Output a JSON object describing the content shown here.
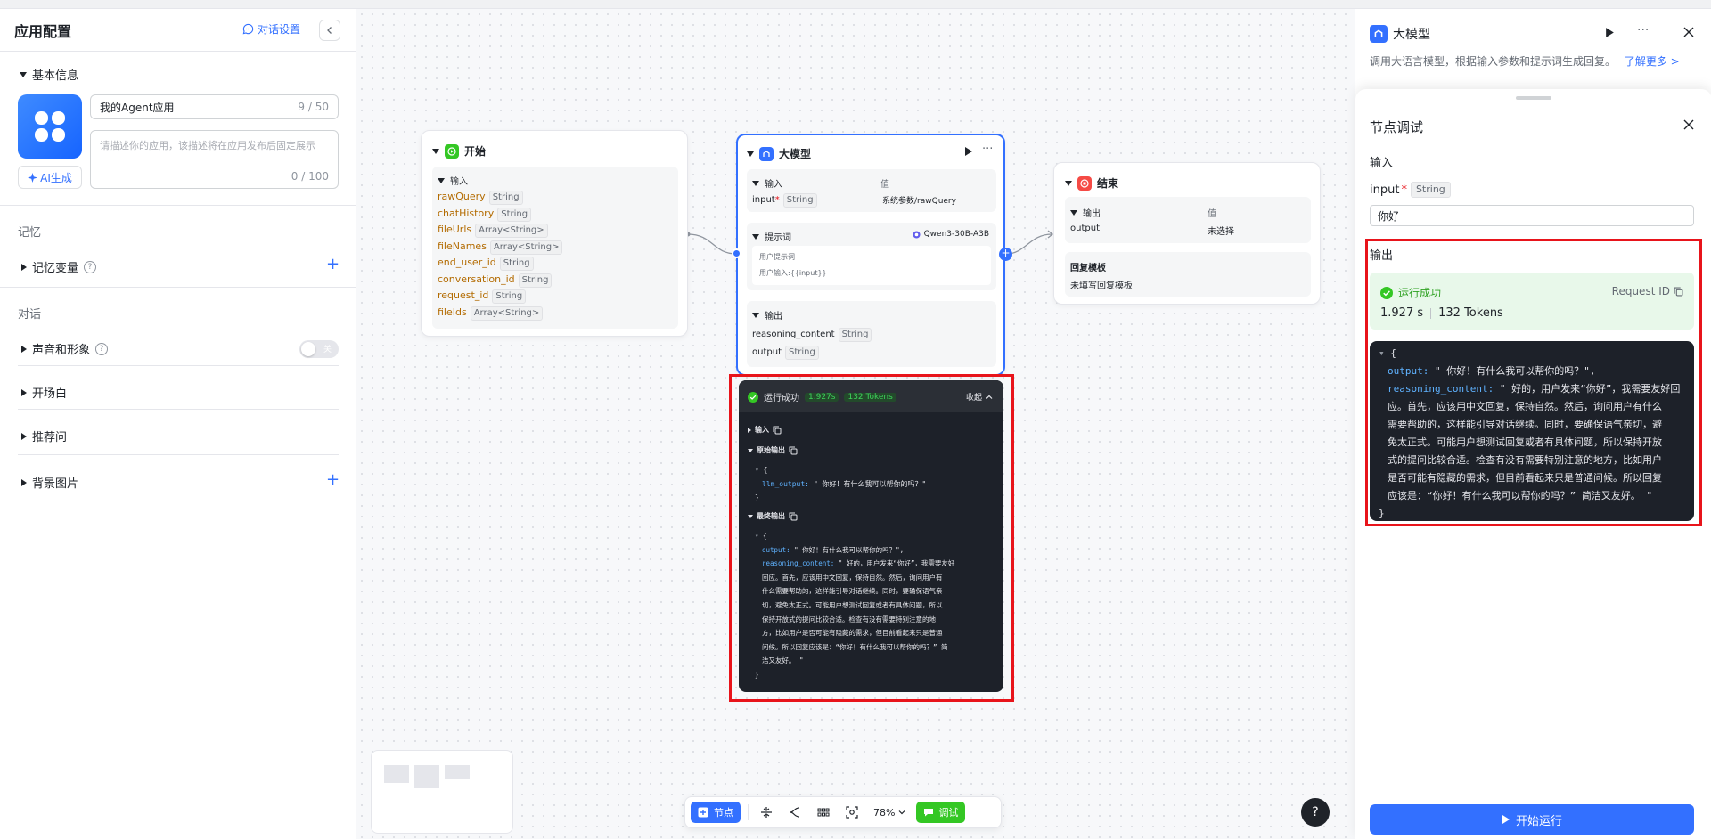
{
  "left": {
    "title": "应用配置",
    "conv_settings": "对话设置",
    "basic_info": "基本信息",
    "app_name": "我的Agent应用",
    "name_count": "9 / 50",
    "desc_placeholder": "请描述你的应用，该描述将在应用发布后固定展示",
    "desc_count": "0 / 100",
    "ai_gen": "AI生成",
    "memory": "记忆",
    "memory_vars": "记忆变量",
    "dialog": "对话",
    "voice": "声音和形象",
    "voice_toggle": "关",
    "opening": "开场白",
    "suggest": "推荐问",
    "bg_image": "背景图片"
  },
  "start_node": {
    "title": "开始",
    "input_label": "输入",
    "vars": [
      {
        "name": "rawQuery",
        "type": "String"
      },
      {
        "name": "chatHistory",
        "type": "String"
      },
      {
        "name": "fileUrls",
        "type": "Array<String>"
      },
      {
        "name": "fileNames",
        "type": "Array<String>"
      },
      {
        "name": "end_user_id",
        "type": "String"
      },
      {
        "name": "conversation_id",
        "type": "String"
      },
      {
        "name": "request_id",
        "type": "String"
      },
      {
        "name": "fileIds",
        "type": "Array<String>"
      }
    ]
  },
  "llm_node": {
    "title": "大模型",
    "input_label": "输入",
    "value_label": "值",
    "input_var": "input",
    "input_type": "String",
    "input_value": "系统参数/rawQuery",
    "prompt_label": "提示词",
    "model": "Qwen3-30B-A3B",
    "user_prompt": "用户提示词",
    "user_input": "用户输入:{{input}}",
    "output_label": "输出",
    "outputs": [
      {
        "name": "reasoning_content",
        "type": "String"
      },
      {
        "name": "output",
        "type": "String"
      }
    ]
  },
  "end_node": {
    "title": "结束",
    "output_label": "输出",
    "value_label": "值",
    "output_var": "output",
    "output_value": "未选择",
    "template_label": "回复模板",
    "template_value": "未填写回复模板"
  },
  "run_result": {
    "status": "运行成功",
    "time": "1.927s",
    "tokens": "132 Tokens",
    "collapse": "收起",
    "input_label": "输入",
    "raw_output_label": "原始输出",
    "raw_open": "{",
    "raw_key": "llm_output:",
    "raw_val": "\" 你好！有什么我可以帮你的吗？\"",
    "close_brace": "}",
    "final_output_label": "最终输出",
    "final_open": "{",
    "out_key": "output:",
    "out_val": "\" 你好！有什么我可以帮你的吗？\",",
    "reason_key": "reasoning_content:",
    "reason_lines": [
      "\" 好的，用户发来“你好”，我需要友好",
      "回应。首先，应该用中文回复，保持自然。然后，询问用户有",
      "什么需要帮助的，这样能引导对话继续。同时，要确保语气亲",
      "切，避免太正式。可能用户想测试回复或者有具体问题，所以",
      "保持开放式的提问比较合适。检查有没有需要特别注意的地",
      "方，比如用户是否可能有隐藏的需求，但目前看起来只是普通",
      "问候。所以回复应该是：“你好！有什么我可以帮你的吗？” 简",
      "洁又友好。 \""
    ],
    "final_close": "}"
  },
  "toolbar": {
    "node_btn": "节点",
    "zoom": "78%",
    "debug_btn": "调试"
  },
  "right": {
    "title": "大模型",
    "desc": "调用大语言模型，根据输入参数和提示词生成回复。",
    "learn_more": "了解更多 >",
    "debug_title": "节点调试",
    "input_label": "输入",
    "input_var": "input",
    "required": "*",
    "input_type": "String",
    "input_value": "你好",
    "output_label": "输出",
    "status": "运行成功",
    "request_id": "Request ID",
    "time": "1.927 s",
    "tokens": "132 Tokens",
    "json_open": "{",
    "out_key": "output:",
    "out_val": "\" 你好！有什么我可以帮你的吗？\",",
    "reason_key": "reasoning_content:",
    "reason_lines": [
      "\" 好的，用户发来“你好”，我需要友好回",
      "应。首先，应该用中文回复，保持自然。然后，询问用户有什么",
      "需要帮助的，这样能引导对话继续。同时，要确保语气亲切，避",
      "免太正式。可能用户想测试回复或者有具体问题，所以保持开放",
      "式的提问比较合适。检查有没有需要特别注意的地方，比如用户",
      "是否可能有隐藏的需求，但目前看起来只是普通问候。所以回复",
      "应该是：“你好！有什么我可以帮你的吗？” 简洁又友好。 \""
    ],
    "json_close": "}",
    "run_btn": "开始运行"
  },
  "colors": {
    "accent": "#3370ff",
    "success": "#34c724",
    "highlight": "#e8141b",
    "code_bg": "#1d2129"
  }
}
